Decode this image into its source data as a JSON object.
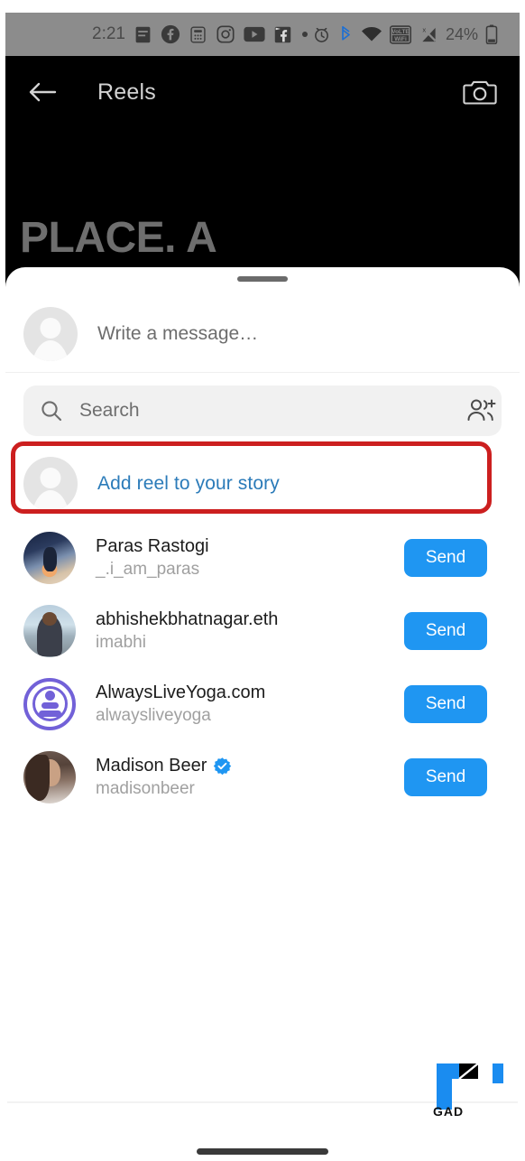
{
  "status_bar": {
    "time": "2:21",
    "battery_percent": "24%",
    "left_icons": [
      "notes-icon",
      "facebook-icon",
      "calculator-icon",
      "instagram-icon",
      "youtube-icon",
      "facebook-gaming-icon",
      "overflow-dot-icon"
    ],
    "right_icons": [
      "alarm-icon",
      "bluetooth-icon",
      "wifi-icon",
      "volte-wifi-icon",
      "signal-off-icon",
      "battery-icon"
    ],
    "background_color": "#8c8c8c"
  },
  "reels_header": {
    "back_icon": "arrow-left-icon",
    "title": "Reels",
    "camera_icon": "camera-icon"
  },
  "reels_video": {
    "caption": "PLACE. A",
    "background_color": "#000000"
  },
  "share_sheet": {
    "grabber": "drag-handle",
    "message": {
      "avatar": "default-avatar-icon",
      "placeholder": "Write a message…"
    },
    "search": {
      "icon": "search-icon",
      "placeholder": "Search",
      "add_people_icon": "add-people-icon",
      "field_background": "#f1f1f1"
    },
    "story": {
      "avatar": "default-avatar-icon",
      "label": "Add reel to your story",
      "label_color": "#2b7bb9",
      "highlight_color": "#cc1f1f",
      "highlighted": true
    },
    "contacts": [
      {
        "name": "Paras Rastogi",
        "username": "_.i_am_paras",
        "verified": false,
        "avatar": "photo-avatar",
        "send_label": "Send"
      },
      {
        "name": "abhishekbhatnagar.eth",
        "username": "imabhi",
        "verified": false,
        "avatar": "photo-avatar",
        "send_label": "Send"
      },
      {
        "name": "AlwaysLiveYoga.com",
        "username": "alwaysliveyoga",
        "verified": false,
        "avatar": "logo-avatar",
        "send_label": "Send"
      },
      {
        "name": "Madison Beer",
        "username": "madisonbeer",
        "verified": true,
        "avatar": "photo-avatar",
        "send_label": "Send"
      }
    ],
    "send_button_color": "#1f96f2",
    "verified_badge_color": "#1f96f2"
  },
  "watermark": {
    "label": "GAD",
    "color": "#1a8cf0"
  },
  "navigation": {
    "gesture_bar": "home-gesture-bar"
  }
}
